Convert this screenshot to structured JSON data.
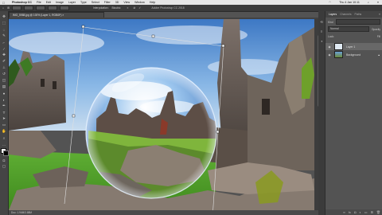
{
  "menubar": {
    "apple": "",
    "app": "Photoshop CC",
    "items": [
      "File",
      "Edit",
      "Image",
      "Layer",
      "Type",
      "Select",
      "Filter",
      "3D",
      "View",
      "Window",
      "Help"
    ],
    "clock": "Thu 4 Jan  10:11"
  },
  "optionsbar": {
    "interpolation": "Interpolation:",
    "mode": "Bicubic"
  },
  "window_title": "Adobe Photoshop CC 2018",
  "document_tab": "IMG_5988.jpg @ 100% (Layer 1, RGB/8*) ×",
  "status": "Doc: 1.94M/3.88M",
  "panel": {
    "tabs": [
      "Layers",
      "Channels",
      "Paths"
    ],
    "kind": "Kind",
    "mode": "Normal",
    "opacity": "Opacity",
    "lock": "Lock:",
    "fill": "Fill",
    "layers": [
      {
        "name": "Layer 1",
        "active": true
      },
      {
        "name": "Background",
        "active": false
      }
    ]
  },
  "colors": {
    "ui_dark": "#535353",
    "sky": "#6aa0d8",
    "grass": "#4f9a2a"
  }
}
